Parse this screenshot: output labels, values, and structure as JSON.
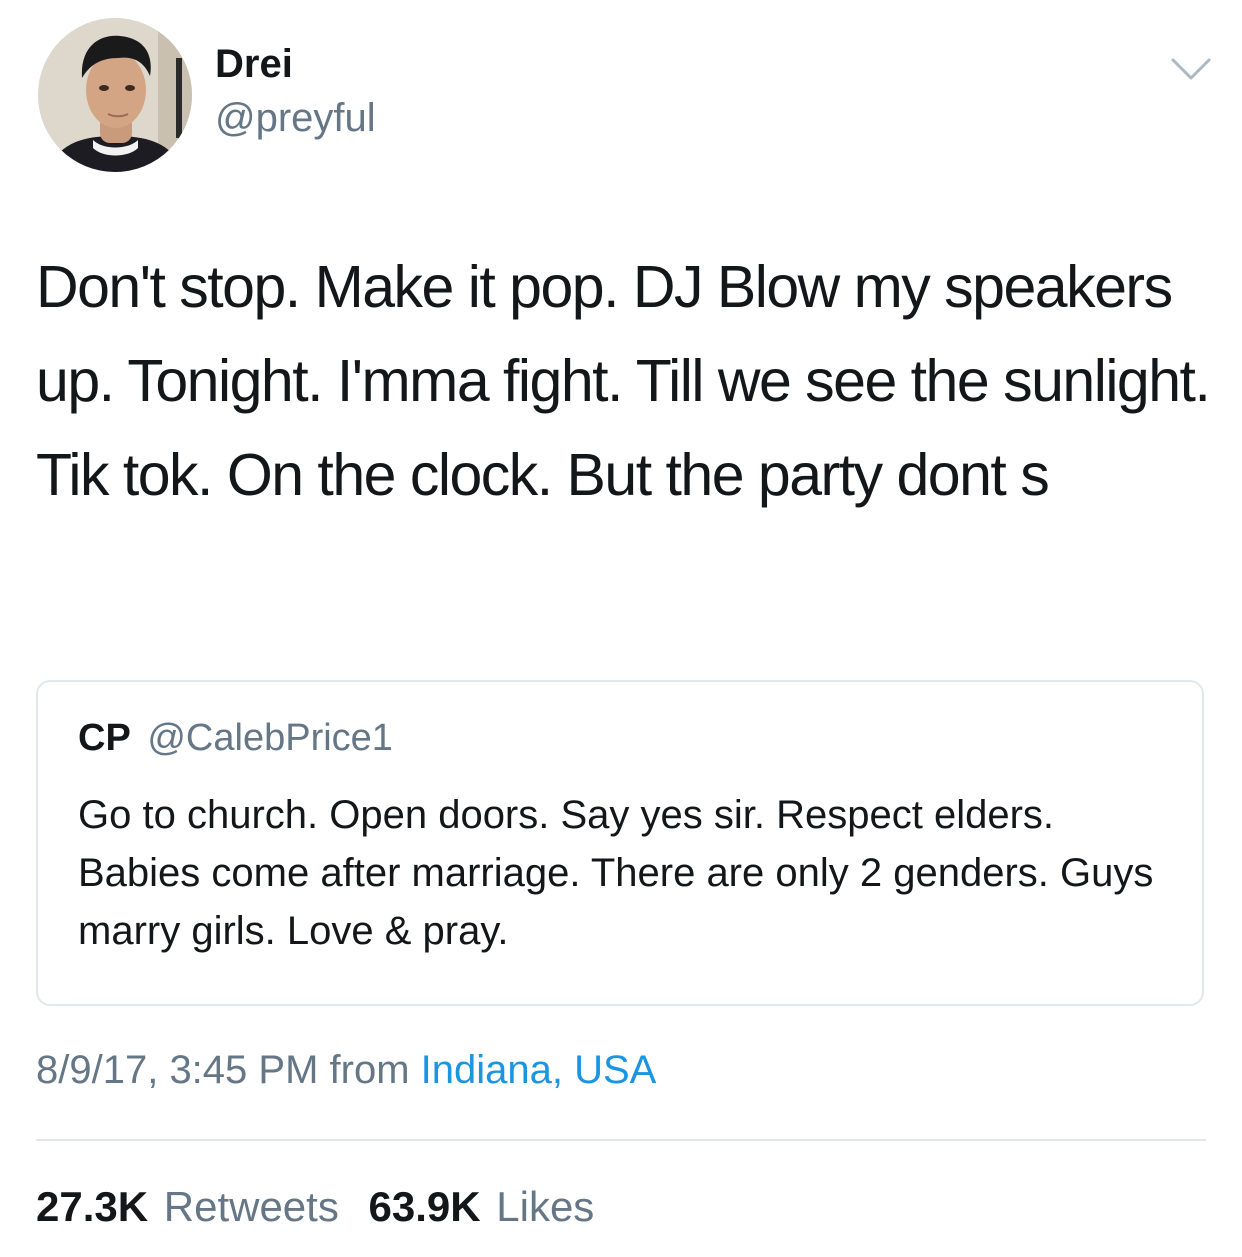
{
  "author": {
    "display_name": "Drei",
    "handle": "@preyful",
    "avatar_icon": "profile-photo"
  },
  "tweet": {
    "text": "Don't stop. Make it pop. DJ Blow my speakers up. Tonight. I'mma fight. Till we see the sunlight. Tik tok. On the clock. But the party dont s"
  },
  "quoted_tweet": {
    "name": "CP",
    "handle": "@CalebPrice1",
    "text": "Go to church. Open doors. Say yes sir. Respect elders. Babies come after marriage. There are only 2 genders. Guys marry girls. Love & pray."
  },
  "meta": {
    "timestamp": "8/9/17, 3:45 PM",
    "from_label": "from",
    "location": "Indiana, USA"
  },
  "stats": {
    "retweets_count": "27.3K",
    "retweets_label": "Retweets",
    "likes_count": "63.9K",
    "likes_label": "Likes"
  },
  "icons": {
    "menu": "chevron-down-icon"
  },
  "colors": {
    "text_primary": "#14171a",
    "text_secondary": "#657786",
    "link": "#1b95e0",
    "border": "#e1e8ed"
  }
}
